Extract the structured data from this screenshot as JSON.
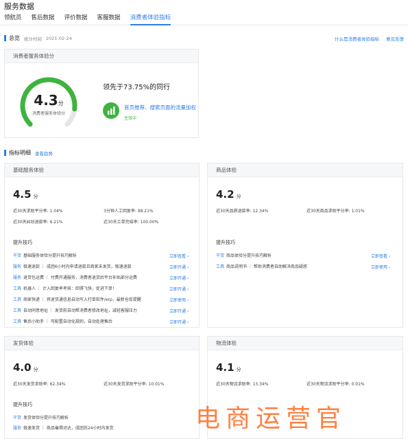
{
  "page": {
    "title": "服务数据"
  },
  "tabs": [
    {
      "label": "领航员"
    },
    {
      "label": "售后数据"
    },
    {
      "label": "评价数据"
    },
    {
      "label": "客服数据"
    },
    {
      "label": "消费者体验指标",
      "active": true
    }
  ],
  "overview": {
    "title": "总览",
    "stat_label": "统计时间",
    "stat_date": "2021-02-24",
    "link1": "什么是消费者体验指标",
    "link2": "意见反馈",
    "card_title": "消费者服务体验分",
    "score": "4.3",
    "score_unit": "分",
    "score_label": "消费者服务体验分",
    "gauge_fraction": 0.86,
    "lead_text": "领先于73.75%的同行",
    "promo_title": "首页推荐、搜索页面的流量加权",
    "promo_status": "生效中"
  },
  "detail": {
    "title": "指标明细",
    "link": "查看趋势"
  },
  "cards": {
    "basic": {
      "title": "基础服务体验",
      "score": "4.5",
      "unit": "分",
      "metrics": [
        "近30天求助平分率: 1.04%",
        "3分钟人工回复率: 98.21%",
        "近30天纠纷退款率: 6.21%",
        "近30天工单完结率: 100.00%"
      ],
      "tips_title": "提升技巧",
      "tips": [
        {
          "tag": "干货",
          "text": "基础服务体验分提升技巧解析",
          "action": "立即查看 ›"
        },
        {
          "tag": "服务",
          "text": "极速退款 ｜ 成团6小时内申请退款且商家未发货，极速退款",
          "action": "立即开通 ›"
        },
        {
          "tag": "服务",
          "text": "退货包运费 ｜ 付费开通服务，消费者退货后平台补贴部分运费",
          "action": "立即开通 ›"
        },
        {
          "tag": "工具",
          "text": "机器人 ｜ 计入回复率考核：回得飞快，促进下单！",
          "action": "立即开通 ›"
        },
        {
          "tag": "工具",
          "text": "商家快递 ｜ 将退货通信息自动写入打单软件/erp，最新仓库提醒",
          "action": "立即使用 ›"
        },
        {
          "tag": "工具",
          "text": "自动同意地址 ｜ 发货前自动帮消费者修改地址，减轻客服压力",
          "action": "立即开通 ›"
        },
        {
          "tag": "工具",
          "text": "售后小助手 ｜ 可配置自动化规则，自动处理售后",
          "action": "立即开通 ›"
        }
      ]
    },
    "product": {
      "title": "商品体验",
      "score": "4.2",
      "unit": "分",
      "metrics": [
        "近30天品质退款率: 12.34%",
        "近30天商品求助平分率: 1.01%"
      ],
      "tips_title": "提升技巧",
      "tips": [
        {
          "tag": "干货",
          "text": "商品体验分提升技巧解析",
          "action": "立即查看 ›"
        },
        {
          "tag": "工具",
          "text": "商品说明书 ｜ 帮助消费者自助解决商品疑惑",
          "action": "立即使用 ›"
        }
      ]
    },
    "shipping": {
      "title": "发货体验",
      "score": "4.0",
      "unit": "分",
      "metrics": [
        "近30天发货求助率: 62.34%",
        "近30天发货求助平分率: 10.01%"
      ],
      "tips_title": "提升技巧",
      "tips": [
        {
          "tag": "干货",
          "text": "发货体验分提升技巧解析",
          "action": ""
        },
        {
          "tag": "服务",
          "text": "极速发货 ｜ 商品催得对达，成团后24小时内发货",
          "action": ""
        }
      ]
    },
    "logistics": {
      "title": "物流体验",
      "score": "4.1",
      "unit": "分",
      "metrics": [
        "近30天物流求助率: 15.34%",
        "近30天物流求助平分率: 0.01%"
      ]
    }
  },
  "watermark": "电商运营官",
  "colors": {
    "accent": "#2b7de9",
    "green": "#3fb33f",
    "watermark": "#ff6a20"
  }
}
